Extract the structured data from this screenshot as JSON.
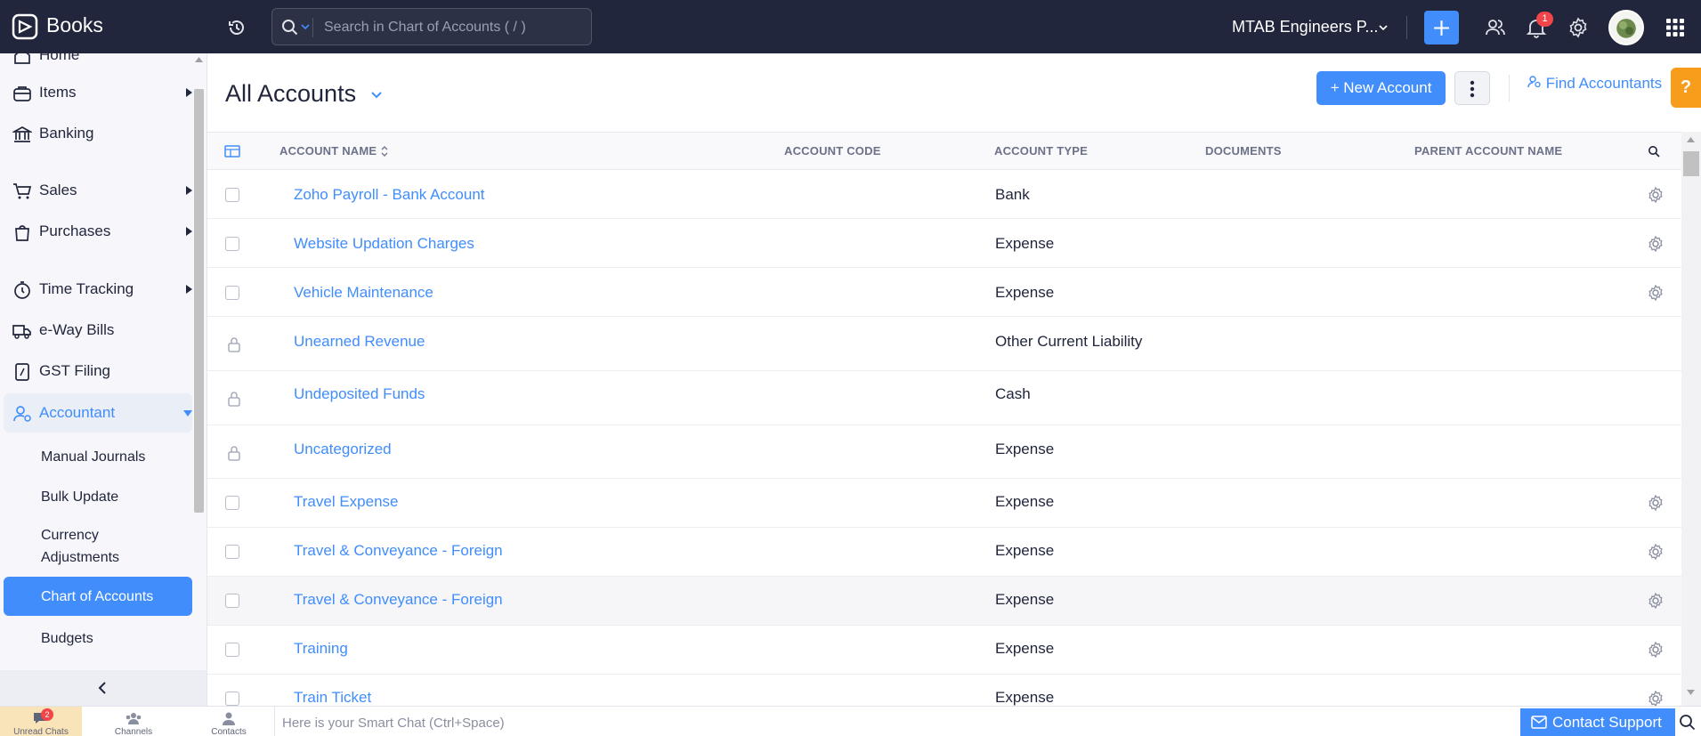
{
  "app": {
    "name": "Books"
  },
  "search": {
    "placeholder": "Search in Chart of Accounts ( / )"
  },
  "org": {
    "name": "MTAB Engineers P..."
  },
  "notifications": {
    "count": "1"
  },
  "sidebar": {
    "partial_top": "Home",
    "items": [
      {
        "label": "Items",
        "icon": "items-bag-icon"
      },
      {
        "label": "Banking",
        "icon": "bank-icon"
      },
      {
        "label": "Sales",
        "icon": "cart-icon"
      },
      {
        "label": "Purchases",
        "icon": "shopping-bag-icon"
      },
      {
        "label": "Time Tracking",
        "icon": "stopwatch-icon"
      },
      {
        "label": "e-Way Bills",
        "icon": "truck-icon"
      },
      {
        "label": "GST Filing",
        "icon": "gst-doc-icon"
      },
      {
        "label": "Accountant",
        "icon": "accountant-user-icon"
      }
    ],
    "sub_items": [
      {
        "label": "Manual Journals"
      },
      {
        "label": "Bulk Update"
      },
      {
        "label": "Currency Adjustments"
      },
      {
        "label": "Chart of Accounts"
      },
      {
        "label": "Budgets"
      }
    ]
  },
  "page": {
    "title": "All Accounts",
    "new_button": "+ New Account",
    "find_accountants": "Find Accountants",
    "help": "?"
  },
  "table": {
    "columns": [
      "ACCOUNT NAME",
      "ACCOUNT CODE",
      "ACCOUNT TYPE",
      "DOCUMENTS",
      "PARENT ACCOUNT NAME"
    ],
    "rows": [
      {
        "name": "Zoho Payroll - Bank Account",
        "type": "Bank",
        "locked": false
      },
      {
        "name": "Website Updation Charges",
        "type": "Expense",
        "locked": false
      },
      {
        "name": "Vehicle Maintenance",
        "type": "Expense",
        "locked": false
      },
      {
        "name": "Unearned Revenue",
        "type": "Other Current Liability",
        "locked": true
      },
      {
        "name": "Undeposited Funds",
        "type": "Cash",
        "locked": true
      },
      {
        "name": "Uncategorized",
        "type": "Expense",
        "locked": true
      },
      {
        "name": "Travel Expense",
        "type": "Expense",
        "locked": false
      },
      {
        "name": "Travel & Conveyance - Foreign",
        "type": "Expense",
        "locked": false
      },
      {
        "name": "Travel & Conveyance - Foreign",
        "type": "Expense",
        "locked": false
      },
      {
        "name": "Training",
        "type": "Expense",
        "locked": false
      },
      {
        "name": "Train Ticket",
        "type": "Expense",
        "locked": false
      }
    ]
  },
  "bottom": {
    "unread_chats": "Unread Chats",
    "unread_count": "2",
    "channels": "Channels",
    "contacts": "Contacts",
    "smart_chat_placeholder": "Here is your Smart Chat (Ctrl+Space)",
    "contact_support": "Contact Support"
  },
  "colors": {
    "accent": "#408dfb",
    "topbar": "#21263c",
    "help": "#f89c1c"
  }
}
